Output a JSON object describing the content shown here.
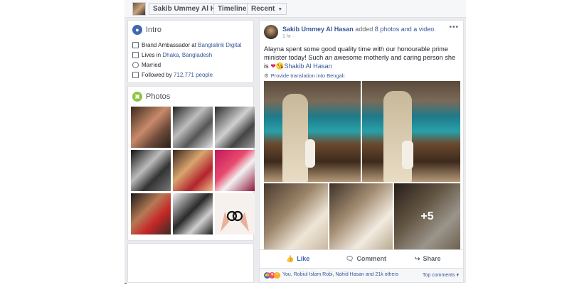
{
  "topbar": {
    "profile_name": "Sakib Ummey Al Hasan",
    "timeline_label": "Timeline",
    "recent_label": "Recent",
    "caret_glyph": "▼"
  },
  "intro": {
    "title": "Intro",
    "icon": "globe-icon",
    "rows": [
      {
        "icon": "briefcase-icon",
        "prefix": "Brand Ambassador at ",
        "link": "Banglalink Digital"
      },
      {
        "icon": "home-icon",
        "prefix": "Lives in ",
        "link": "Dhaka, Bangladesh"
      },
      {
        "icon": "heart-icon",
        "prefix": "Married",
        "link": ""
      },
      {
        "icon": "followers-icon",
        "prefix": "Followed by ",
        "link": "712,771 people"
      }
    ]
  },
  "photos": {
    "title": "Photos",
    "icon": "photos-icon"
  },
  "post": {
    "author": "Sakib Ummey Al Hasan",
    "action_prefix": " added ",
    "action_link": "8 photos and a video",
    "action_suffix": ".",
    "time": "1 hr ·",
    "menu": "•••",
    "text_main": "Alayna spent some good quality time with our honourable prime minister today! Such an awesome motherly and caring person she is ",
    "text_emoji": "❤😘",
    "text_link": "Shakib Al Hasan",
    "translate": "Provide translation into Bengali",
    "more_count": "+5",
    "like_label": "Like",
    "comment_label": "Comment",
    "share_label": "Share",
    "reactions_text": "You, Robiul Islam Robi, Nahid Hasan and 21k others",
    "top_comments": "Top comments ▾"
  },
  "colors": {
    "facebook_blue": "#4267b2",
    "link_blue": "#365899",
    "background": "#e9ebee"
  }
}
